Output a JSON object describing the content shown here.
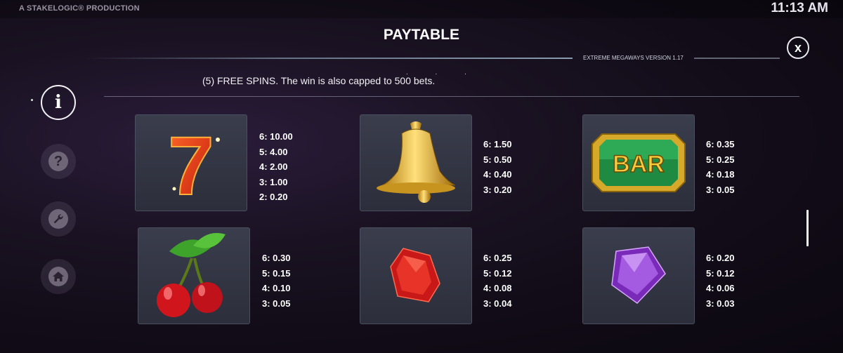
{
  "header": {
    "producer": "A STAKELOGIC® PRODUCTION",
    "clock": "11:13 AM"
  },
  "title": "PAYTABLE",
  "version": "EXTREME MEGAWAYS VERSION 1.17",
  "close_label": "x",
  "snippet": "(5) FREE SPINS. The win is also capped to 500 bets.",
  "snippet_dots": ". . .",
  "sidebar": [
    {
      "name": "info",
      "icon": "info-icon",
      "glyph": "i",
      "active": true
    },
    {
      "name": "help",
      "icon": "question-icon",
      "glyph": "?",
      "active": false
    },
    {
      "name": "settings",
      "icon": "wrench-icon",
      "active": false
    },
    {
      "name": "home",
      "icon": "home-icon",
      "active": false
    }
  ],
  "symbols": [
    {
      "name": "seven",
      "icon": "seven-symbol-icon",
      "label": "7",
      "pays": [
        "6: 10.00",
        "5: 4.00",
        "4: 2.00",
        "3: 1.00",
        "2: 0.20"
      ]
    },
    {
      "name": "bell",
      "icon": "bell-symbol-icon",
      "pays": [
        "6: 1.50",
        "5: 0.50",
        "4: 0.40",
        "3: 0.20"
      ]
    },
    {
      "name": "bar",
      "icon": "bar-symbol-icon",
      "label": "BAR",
      "pays": [
        "6: 0.35",
        "5: 0.25",
        "4: 0.18",
        "3: 0.05"
      ]
    },
    {
      "name": "cherry",
      "icon": "cherry-symbol-icon",
      "pays": [
        "6: 0.30",
        "5: 0.15",
        "4: 0.10",
        "3: 0.05"
      ]
    },
    {
      "name": "red-gem",
      "icon": "red-gem-symbol-icon",
      "pays": [
        "6: 0.25",
        "5: 0.12",
        "4: 0.08",
        "3: 0.04"
      ]
    },
    {
      "name": "purple-gem",
      "icon": "purple-gem-symbol-icon",
      "pays": [
        "6: 0.20",
        "5: 0.12",
        "4: 0.06",
        "3: 0.03"
      ]
    }
  ],
  "colors": {
    "background": "#160f1d",
    "card": "#33364a",
    "accent_red": "#e8321a",
    "gold": "#d9a520",
    "green": "#1e9a4a",
    "purple": "#9a4fd8"
  }
}
